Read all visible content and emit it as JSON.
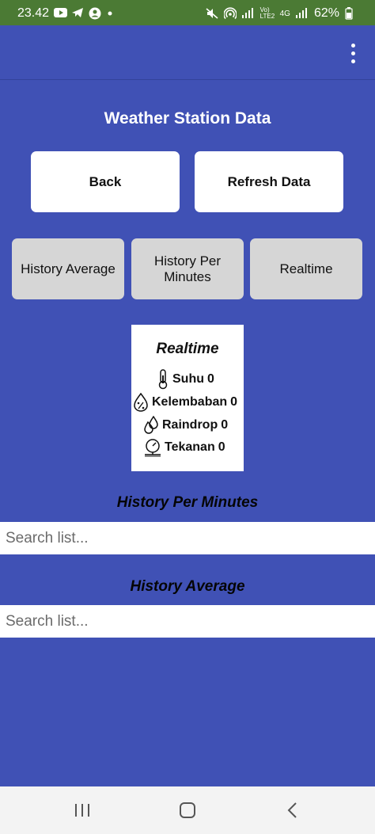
{
  "status_bar": {
    "time": "23.42",
    "network_label": "Vo) LTE2",
    "network_type": "4G",
    "battery": "62%",
    "icons": [
      "youtube-icon",
      "telegram-icon",
      "account-icon",
      "dot-icon",
      "mute-icon",
      "hotspot-icon",
      "signal-icon",
      "signal-icon",
      "battery-icon"
    ]
  },
  "app_bar": {
    "menu_icon": "more-vert-icon"
  },
  "page": {
    "title": "Weather Station Data"
  },
  "buttons": {
    "back": "Back",
    "refresh": "Refresh Data"
  },
  "view_buttons": {
    "history_average": "History Average",
    "history_per_minutes": "History Per Minutes",
    "realtime": "Realtime"
  },
  "realtime_card": {
    "title": "Realtime",
    "sensors": [
      {
        "label": "Suhu",
        "value": "0",
        "icon": "thermometer-icon"
      },
      {
        "label": "Kelembaban",
        "value": "0",
        "icon": "humidity-icon"
      },
      {
        "label": "Raindrop",
        "value": "0",
        "icon": "raindrop-icon"
      },
      {
        "label": "Tekanan",
        "value": "0",
        "icon": "pressure-gauge-icon"
      }
    ]
  },
  "history_per_minutes": {
    "title": "History Per Minutes",
    "search_placeholder": "Search list..."
  },
  "history_average": {
    "title": "History Average",
    "search_placeholder": "Search list..."
  },
  "colors": {
    "background": "#4051b5",
    "status_bar": "#4b7a34",
    "button_white": "#ffffff",
    "button_grey": "#d6d6d6",
    "nav_bar": "#f3f3f3"
  },
  "nav_bar": {
    "icons": [
      "recents-icon",
      "home-icon",
      "back-nav-icon"
    ]
  }
}
